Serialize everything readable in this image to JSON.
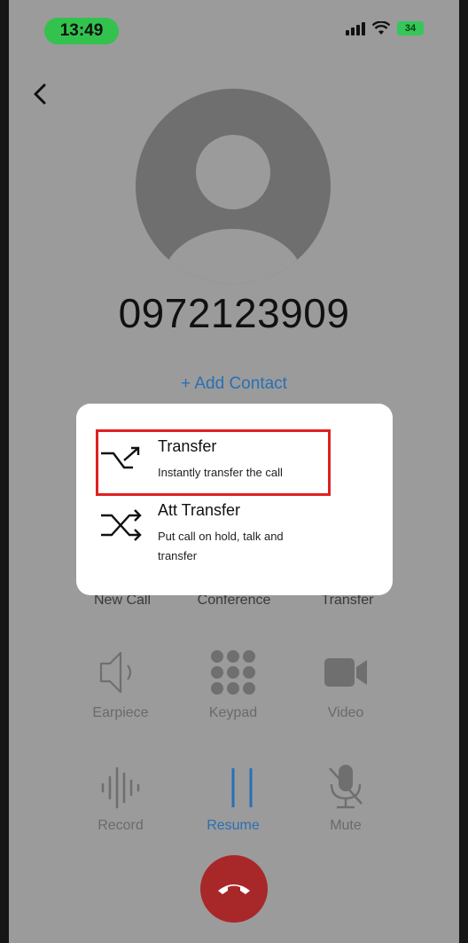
{
  "status_bar": {
    "time": "13:49",
    "battery": "34"
  },
  "contact": {
    "number": "0972123909",
    "add_contact_label": "+ Add Contact"
  },
  "actions_row1": [
    "New Call",
    "Conference",
    "Transfer"
  ],
  "actions_row2": [
    "Earpiece",
    "Keypad",
    "Video"
  ],
  "actions_row3": [
    "Record",
    "Resume",
    "Mute"
  ],
  "popup": {
    "options": [
      {
        "title": "Transfer",
        "subtitle": "Instantly transfer the call"
      },
      {
        "title": "Att Transfer",
        "subtitle": "Put call on hold, talk and transfer"
      }
    ]
  },
  "colors": {
    "accent_blue": "#2a6fb4",
    "highlight_red": "#e02020",
    "end_call": "#a8282a",
    "time_pill": "#32c24d"
  },
  "icons": {
    "back": "chevron-left-icon",
    "transfer": "transfer-arrow-icon",
    "att_transfer": "shuffle-icon",
    "earpiece": "speaker-icon",
    "keypad": "keypad-icon",
    "video": "video-camera-icon",
    "record": "waveform-icon",
    "resume": "pause-icon",
    "mute": "mic-off-icon",
    "end_call": "phone-hangup-icon"
  }
}
